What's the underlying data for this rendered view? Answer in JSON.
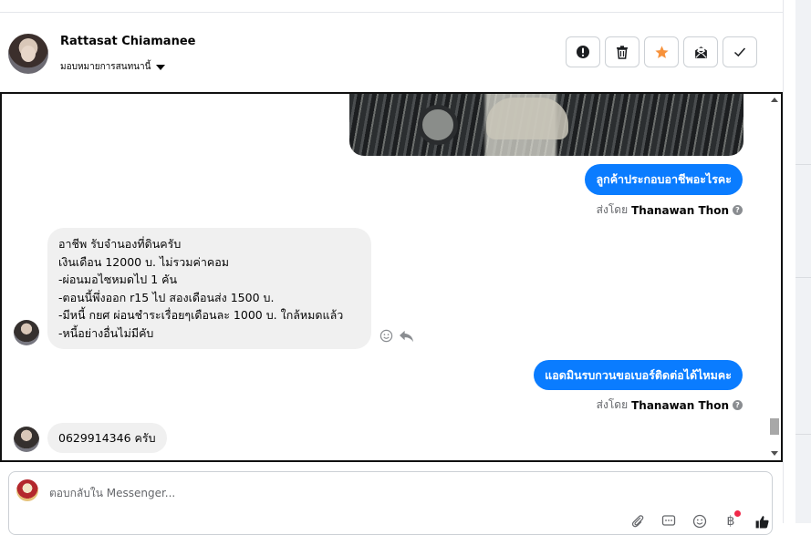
{
  "contact": {
    "name": "Rattasat Chiamanee",
    "assign_label": "มอบหมายการสนทนานี้"
  },
  "actions": [
    {
      "icon": "alert-circle-icon",
      "name": "mark-spam-button"
    },
    {
      "icon": "trash-icon",
      "name": "delete-button"
    },
    {
      "icon": "star-icon",
      "name": "star-button",
      "color": "#f7923b"
    },
    {
      "icon": "mark-unread-icon",
      "name": "mark-unread-button"
    },
    {
      "icon": "check-icon",
      "name": "mark-done-button"
    }
  ],
  "messages": {
    "out_1": "ลูกค้าประกอบอาชีพอะไรคะ",
    "sent_by_prefix": "ส่งโดย",
    "sent_by_name": "Thanawan Thon",
    "in_1": [
      "อาชีพ รับจำนองที่ดินครับ",
      "เงินเดือน 12000 บ. ไม่รวมค่าคอม",
      "-ผ่อนมอไซหมดไป 1 คัน",
      "-ตอนนี้พึ่งออก r15 ไป สองเดือนส่ง 1500 บ.",
      "-มีหนี้ กยศ ผ่อนชำระเรื่อยๆเดือนละ 1000 บ. ใกล้หมดแล้ว",
      "-หนี้อย่างอื่นไม่มีคับ"
    ],
    "out_2": "แอดมินรบกวนขอเบอร์ติดต่อได้ไหมคะ",
    "in_2": "0629914346 ครับ"
  },
  "composer": {
    "placeholder": "ตอบกลับใน Messenger..."
  },
  "colors": {
    "brand_blue": "#0a7cff",
    "incoming_bubble": "#f0f0f0",
    "star_orange": "#f7923b"
  }
}
